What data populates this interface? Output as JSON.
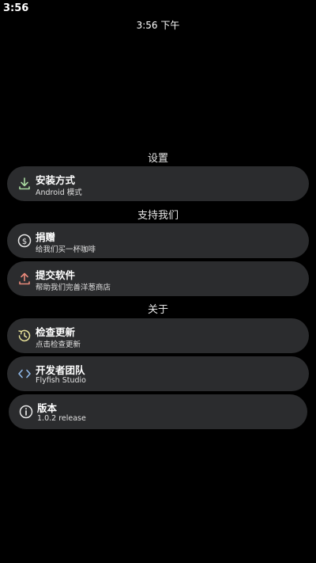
{
  "status_bar": {
    "time": "3:56"
  },
  "clock": {
    "text": "3:56 下午"
  },
  "sections": {
    "settings": {
      "header": "设置",
      "items": [
        {
          "title": "安装方式",
          "subtitle": "Android 模式",
          "icon": "download-icon",
          "icon_color": "#a8d8a0"
        }
      ]
    },
    "support": {
      "header": "支持我们",
      "items": [
        {
          "title": "捐赠",
          "subtitle": "给我们买一杯咖啡",
          "icon": "dollar-coin-icon",
          "icon_color": "#e8e8e8"
        },
        {
          "title": "提交软件",
          "subtitle": "帮助我们完善洋葱商店",
          "icon": "upload-icon",
          "icon_color": "#e8897a"
        }
      ]
    },
    "about": {
      "header": "关于",
      "items": [
        {
          "title": "检查更新",
          "subtitle": "点击检查更新",
          "icon": "update-clock-icon",
          "icon_color": "#e8e29a"
        },
        {
          "title": "开发者团队",
          "subtitle": "Flyfish Studio",
          "icon": "code-brackets-icon",
          "icon_color": "#8fb8e8"
        },
        {
          "title": "版本",
          "subtitle": "1.0.2 release",
          "icon": "info-icon",
          "icon_color": "#e8e8e8"
        }
      ]
    }
  }
}
